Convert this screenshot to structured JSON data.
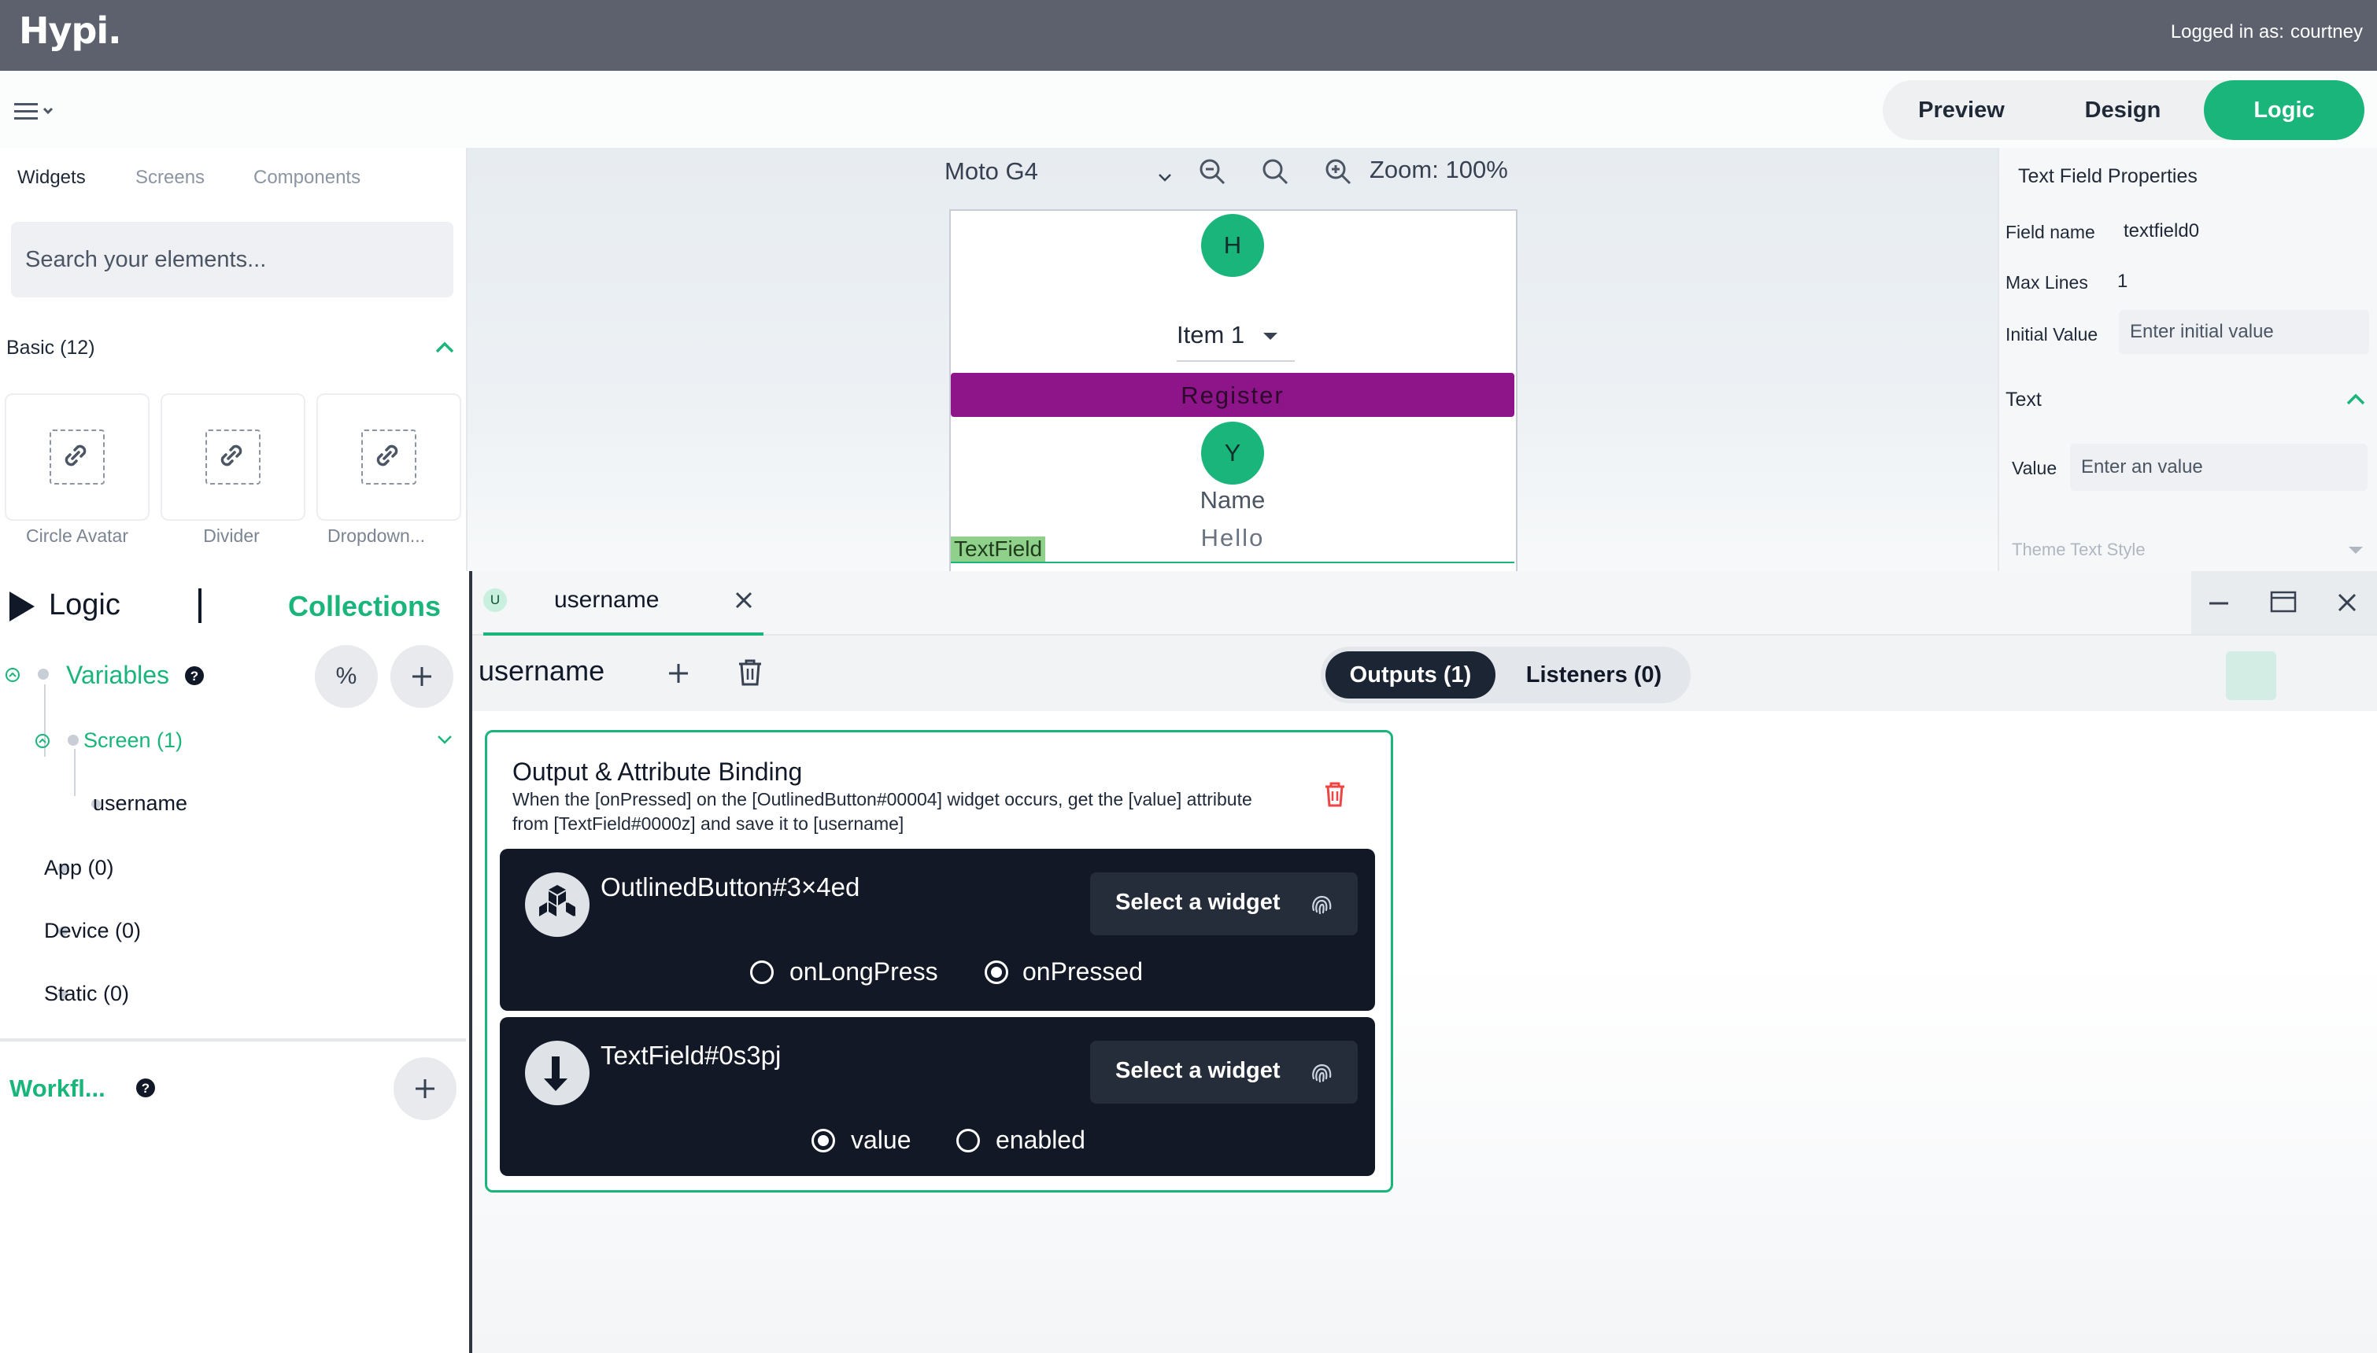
{
  "topbar": {
    "logo": "Hypi.",
    "logged_in_label": "Logged in as:",
    "username": "courtney"
  },
  "modes": {
    "preview": "Preview",
    "design": "Design",
    "logic": "Logic",
    "active": "Logic",
    "accent": "#19b57b"
  },
  "widgets_panel": {
    "tabs": [
      "Widgets",
      "Screens",
      "Components"
    ],
    "search_placeholder": "Search your elements...",
    "group_label": "Basic (12)",
    "items": [
      {
        "label": "Circle Avatar",
        "icon": "link-icon"
      },
      {
        "label": "Divider",
        "icon": "link-icon"
      },
      {
        "label": "Dropdown...",
        "icon": "link-icon"
      }
    ]
  },
  "canvas": {
    "device": "Moto G4",
    "zoom_label": "Zoom: 100%",
    "preview": {
      "avatar_top": "H",
      "dropdown_value": "Item 1",
      "register_label": "Register",
      "avatar_bottom": "Y",
      "name_text": "Name",
      "hello_text": "Hello",
      "textfield_tag": "TextField"
    }
  },
  "properties": {
    "title": "Text Field Properties",
    "field_name_label": "Field name",
    "field_name_value": "textfield0",
    "max_lines_label": "Max Lines",
    "max_lines_value": "1",
    "initial_value_label": "Initial Value",
    "initial_value_placeholder": "Enter initial value",
    "text_section": "Text",
    "value_label": "Value",
    "value_placeholder": "Enter an value",
    "theme_text_style": "Theme Text Style"
  },
  "logic_panel": {
    "logic_label": "Logic",
    "collections_label": "Collections",
    "variables_label": "Variables",
    "percent_label": "%",
    "screen_label": "Screen (1)",
    "screen_items": [
      "username"
    ],
    "app_label": "App (0)",
    "device_label": "Device (0)",
    "static_label": "Static (0)",
    "workflows_label": "Workfl..."
  },
  "editor": {
    "tab_badge": "U",
    "tab_label": "username",
    "var_name": "username",
    "outputs_label": "Outputs (1)",
    "listeners_label": "Listeners (0)",
    "binding": {
      "title": "Output & Attribute Binding",
      "description": "When the [onPressed] on the [OutlinedButton#00004] widget occurs, get the [value] attribute from [TextField#0000z] and save it to [username]",
      "source": {
        "widget": "OutlinedButton#3×4ed",
        "select_label": "Select a widget",
        "options": [
          "onLongPress",
          "onPressed"
        ],
        "selected": "onPressed"
      },
      "target": {
        "widget": "TextField#0s3pj",
        "select_label": "Select a widget",
        "options": [
          "value",
          "enabled"
        ],
        "selected": "value"
      }
    }
  }
}
